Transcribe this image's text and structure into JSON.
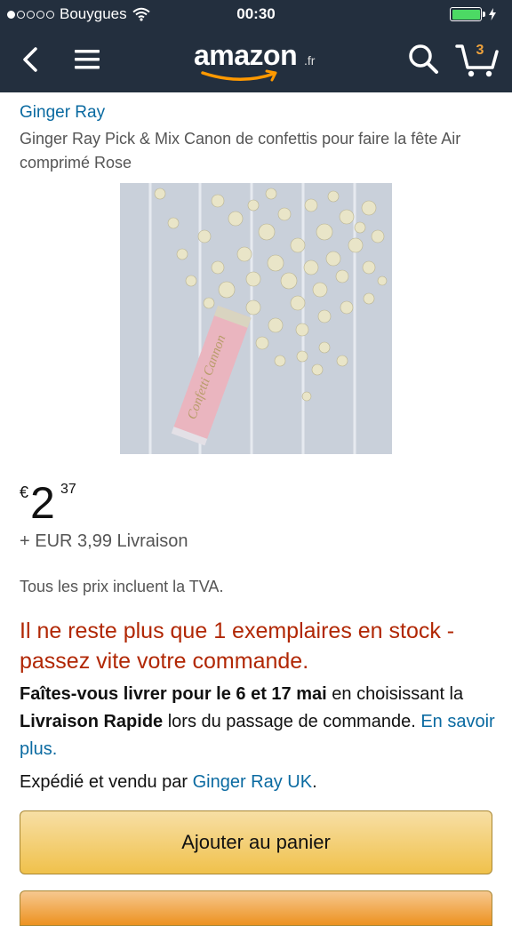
{
  "status_bar": {
    "carrier": "Bouygues",
    "time": "00:30"
  },
  "nav": {
    "logo_text": "amazon",
    "logo_suffix": ".fr",
    "cart_count": "3"
  },
  "product": {
    "brand": "Ginger Ray",
    "title": "Ginger Ray Pick & Mix Canon de confettis pour faire la fête Air comprimé Rose",
    "image_text": "Confetti Cannon"
  },
  "pricing": {
    "currency": "€",
    "whole": "2",
    "fraction": "37",
    "shipping": "+ EUR 3,99 Livraison",
    "tva_note": "Tous les prix incluent la TVA."
  },
  "stock_message": "Il ne reste plus que 1 exemplaires en stock - passez vite votre commande.",
  "delivery": {
    "part1": "Faîtes-vous livrer pour le 6 et 17 mai",
    "part2": " en choisissant la ",
    "part3": "Livraison Rapide",
    "part4": " lors du passage de commande. ",
    "link": "En savoir plus."
  },
  "seller": {
    "prefix": "Expédié et vendu par ",
    "name": "Ginger Ray UK",
    "suffix": "."
  },
  "buttons": {
    "add_to_cart": "Ajouter au panier"
  },
  "colors": {
    "header_bg": "#232f3e",
    "link": "#0a6aa1",
    "stock_red": "#b12704",
    "cart_button": "#f0c14b",
    "buy_button": "#ed9220"
  }
}
